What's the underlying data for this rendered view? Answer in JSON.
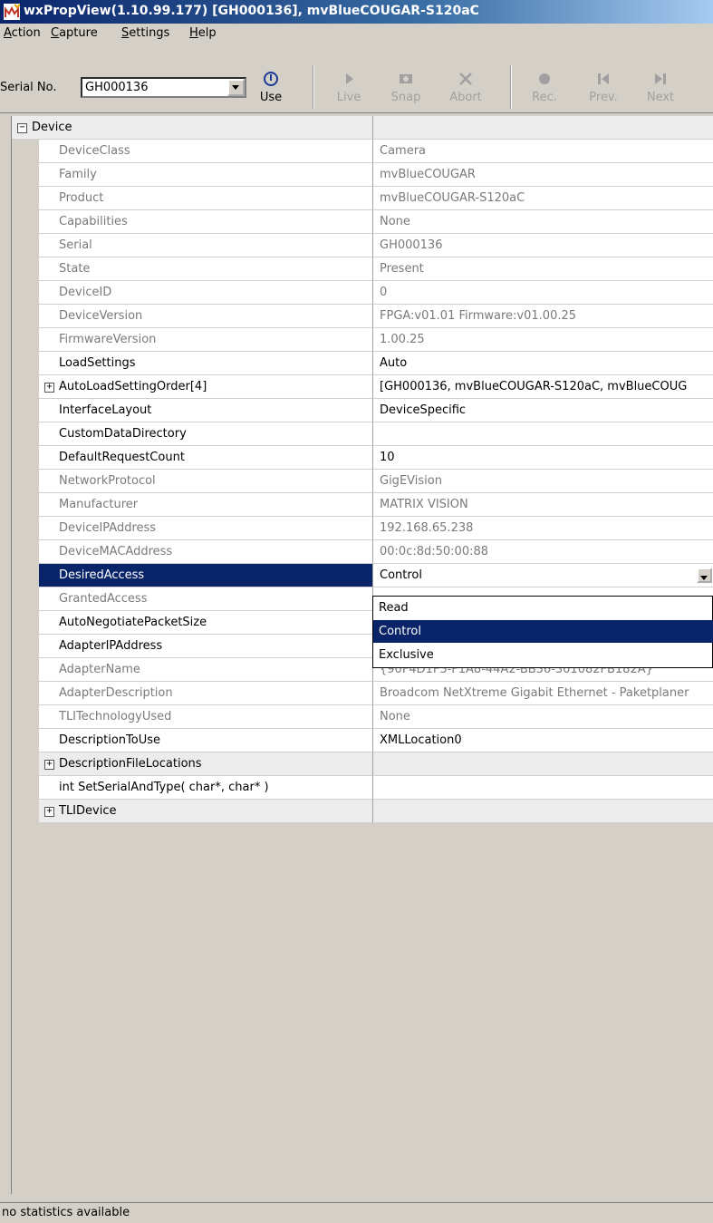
{
  "window": {
    "title": "wxPropView(1.10.99.177) [GH000136], mvBlueCOUGAR-S120aC"
  },
  "menu": [
    {
      "label": "Action",
      "accel": "A"
    },
    {
      "label": "Capture",
      "accel": "C"
    },
    {
      "label": "Settings",
      "accel": "S"
    },
    {
      "label": "Help",
      "accel": "H"
    }
  ],
  "toolbar": {
    "serial_label": "Serial No.",
    "serial_value": "GH000136",
    "buttons": [
      {
        "label": "Use",
        "icon": "power-icon",
        "enabled": true
      },
      {
        "label": "Live",
        "icon": "play-icon",
        "enabled": false
      },
      {
        "label": "Snap",
        "icon": "camera-icon",
        "enabled": false
      },
      {
        "label": "Abort",
        "icon": "x-icon",
        "enabled": false
      },
      {
        "label": "Rec.",
        "icon": "record-icon",
        "enabled": false
      },
      {
        "label": "Prev.",
        "icon": "prev-icon",
        "enabled": false
      },
      {
        "label": "Next",
        "icon": "next-icon",
        "enabled": false
      }
    ]
  },
  "properties": [
    {
      "name": "Device",
      "value": "",
      "type": "group-top",
      "expand": "minus"
    },
    {
      "name": "DeviceClass",
      "value": "Camera",
      "readonly": true
    },
    {
      "name": "Family",
      "value": "mvBlueCOUGAR",
      "readonly": true
    },
    {
      "name": "Product",
      "value": "mvBlueCOUGAR-S120aC",
      "readonly": true
    },
    {
      "name": "Capabilities",
      "value": "None",
      "readonly": true
    },
    {
      "name": "Serial",
      "value": "GH000136",
      "readonly": true
    },
    {
      "name": "State",
      "value": "Present",
      "readonly": true
    },
    {
      "name": "DeviceID",
      "value": "0",
      "readonly": true
    },
    {
      "name": "DeviceVersion",
      "value": "FPGA:v01.01 Firmware:v01.00.25",
      "readonly": true
    },
    {
      "name": "FirmwareVersion",
      "value": "1.00.25",
      "readonly": true
    },
    {
      "name": "LoadSettings",
      "value": "Auto",
      "readonly": false
    },
    {
      "name": "AutoLoadSettingOrder[4]",
      "value": "[GH000136, mvBlueCOUGAR-S120aC, mvBlueCOUG",
      "readonly": false,
      "expand": "plus"
    },
    {
      "name": "InterfaceLayout",
      "value": "DeviceSpecific",
      "readonly": false
    },
    {
      "name": "CustomDataDirectory",
      "value": "",
      "readonly": false
    },
    {
      "name": "DefaultRequestCount",
      "value": "10",
      "readonly": false
    },
    {
      "name": "NetworkProtocol",
      "value": "GigEVision",
      "readonly": true
    },
    {
      "name": "Manufacturer",
      "value": "MATRIX VISION",
      "readonly": true
    },
    {
      "name": "DeviceIPAddress",
      "value": "192.168.65.238",
      "readonly": true
    },
    {
      "name": "DeviceMACAddress",
      "value": "00:0c:8d:50:00:88",
      "readonly": true
    },
    {
      "name": "DesiredAccess",
      "value": "Control",
      "readonly": false,
      "selected": true,
      "dropdown": true
    },
    {
      "name": "GrantedAccess",
      "value": "",
      "readonly": true
    },
    {
      "name": "AutoNegotiatePacketSize",
      "value": "",
      "readonly": false
    },
    {
      "name": "AdapterIPAddress",
      "value": "",
      "readonly": false
    },
    {
      "name": "AdapterName",
      "value": "{90F4D1F3-F1A8-44A2-BB36-301082FB182A}",
      "readonly": true
    },
    {
      "name": "AdapterDescription",
      "value": "Broadcom NetXtreme Gigabit Ethernet - Paketplaner",
      "readonly": true
    },
    {
      "name": "TLITechnologyUsed",
      "value": "None",
      "readonly": true
    },
    {
      "name": "DescriptionToUse",
      "value": "XMLLocation0",
      "readonly": false
    },
    {
      "name": "DescriptionFileLocations",
      "value": "",
      "type": "group",
      "expand": "plus"
    },
    {
      "name": "int SetSerialAndType( char*, char* )",
      "value": "",
      "readonly": false
    },
    {
      "name": "TLIDevice",
      "value": "",
      "type": "group",
      "expand": "plus"
    }
  ],
  "dropdown_options": [
    "Read",
    "Control",
    "Exclusive"
  ],
  "dropdown_selected": "Control",
  "status": "no statistics available"
}
